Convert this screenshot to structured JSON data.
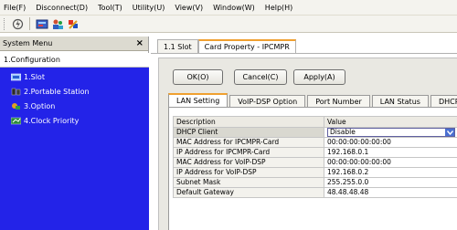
{
  "menubar": {
    "items": [
      "File(F)",
      "Disconnect(D)",
      "Tool(T)",
      "Utility(U)",
      "View(V)",
      "Window(W)",
      "Help(H)"
    ]
  },
  "toolbar": {
    "icons": [
      "lightning-icon",
      "card-icon",
      "users-icon",
      "settings-icon"
    ]
  },
  "sidebar": {
    "title": "System Menu",
    "close": "×",
    "root": "1.Configuration",
    "items": [
      {
        "label": "1.Slot",
        "icon": "slot-icon"
      },
      {
        "label": "2.Portable Station",
        "icon": "portable-station-icon"
      },
      {
        "label": "3.Option",
        "icon": "option-icon"
      },
      {
        "label": "4.Clock Priority",
        "icon": "clock-priority-icon"
      }
    ]
  },
  "doc_tabs": [
    "1.1 Slot",
    "Card Property - IPCMPR"
  ],
  "buttons": {
    "ok": "OK(O)",
    "cancel": "Cancel(C)",
    "apply": "Apply(A)"
  },
  "sub_tabs": [
    "LAN Setting",
    "VoIP-DSP Option",
    "Port Number",
    "LAN Status",
    "DHCP"
  ],
  "table": {
    "headers": [
      "Description",
      "Value"
    ],
    "rows": [
      {
        "desc": "DHCP Client",
        "value": "Disable",
        "type": "select"
      },
      {
        "desc": "MAC Address for IPCMPR-Card",
        "value": "00:00:00:00:00:00"
      },
      {
        "desc": "IP Address for IPCMPR-Card",
        "value": "192.168.0.1"
      },
      {
        "desc": "MAC Address for VoIP-DSP",
        "value": "00:00:00:00:00:00"
      },
      {
        "desc": "IP Address for VoIP-DSP",
        "value": "192.168.0.2"
      },
      {
        "desc": "Subnet Mask",
        "value": "255.255.0.0"
      },
      {
        "desc": "Default Gateway",
        "value": "48.48.48.48"
      }
    ]
  },
  "colors": {
    "accent_tab": "#f0a030",
    "tree_bg": "#2323e8",
    "select_arrow": "#4a6fd0"
  }
}
